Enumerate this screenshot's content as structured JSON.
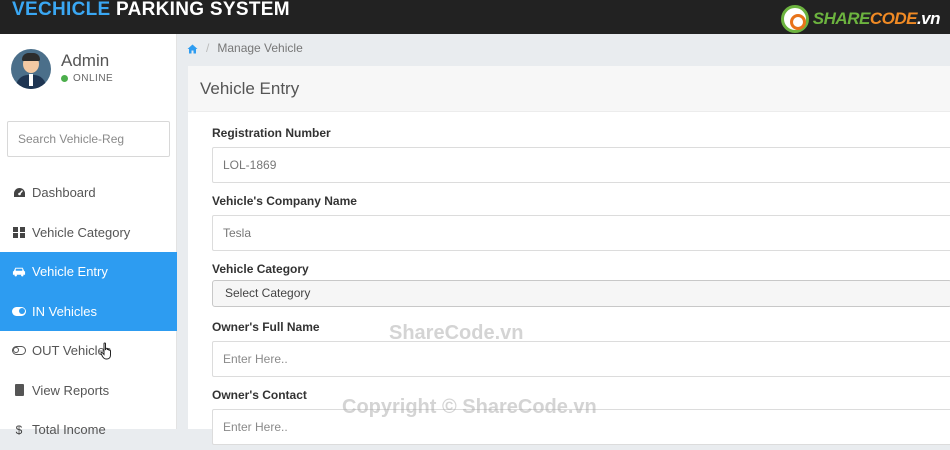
{
  "header": {
    "brand_part1": "VECHICLE",
    "brand_part2": " PARKING SYSTEM",
    "watermark_logo": {
      "share": "SHARE",
      "code": "CODE",
      "vn": ".vn"
    }
  },
  "user": {
    "name": "Admin",
    "status": "ONLINE"
  },
  "search": {
    "placeholder": "Search Vehicle-Reg"
  },
  "sidebar": {
    "items": [
      {
        "label": "Dashboard",
        "icon": "dashboard-icon"
      },
      {
        "label": "Vehicle Category",
        "icon": "grid-icon"
      },
      {
        "label": "Vehicle Entry",
        "icon": "car-icon",
        "active": true
      },
      {
        "label": "IN Vehicles",
        "icon": "toggle-on-icon",
        "active": true
      },
      {
        "label": "OUT Vehicles",
        "icon": "toggle-off-icon"
      },
      {
        "label": "View Reports",
        "icon": "file-icon"
      },
      {
        "label": "Total Income",
        "icon": "dollar-icon"
      }
    ]
  },
  "breadcrumb": {
    "current": "Manage Vehicle"
  },
  "panel": {
    "title": "Vehicle Entry"
  },
  "form": {
    "reg_label": "Registration Number",
    "reg_value": "LOL-1869",
    "company_label": "Vehicle's Company Name",
    "company_value": "Tesla",
    "category_label": "Vehicle Category",
    "category_selected": "Select Category",
    "owner_label": "Owner's Full Name",
    "owner_placeholder": "Enter Here..",
    "contact_label": "Owner's Contact",
    "contact_placeholder": "Enter Here.."
  },
  "watermarks": {
    "center": "ShareCode.vn",
    "bottom": "Copyright © ShareCode.vn"
  },
  "colors": {
    "accent": "#2d9cf1",
    "topbar": "#222222",
    "online": "#4cae4c"
  }
}
